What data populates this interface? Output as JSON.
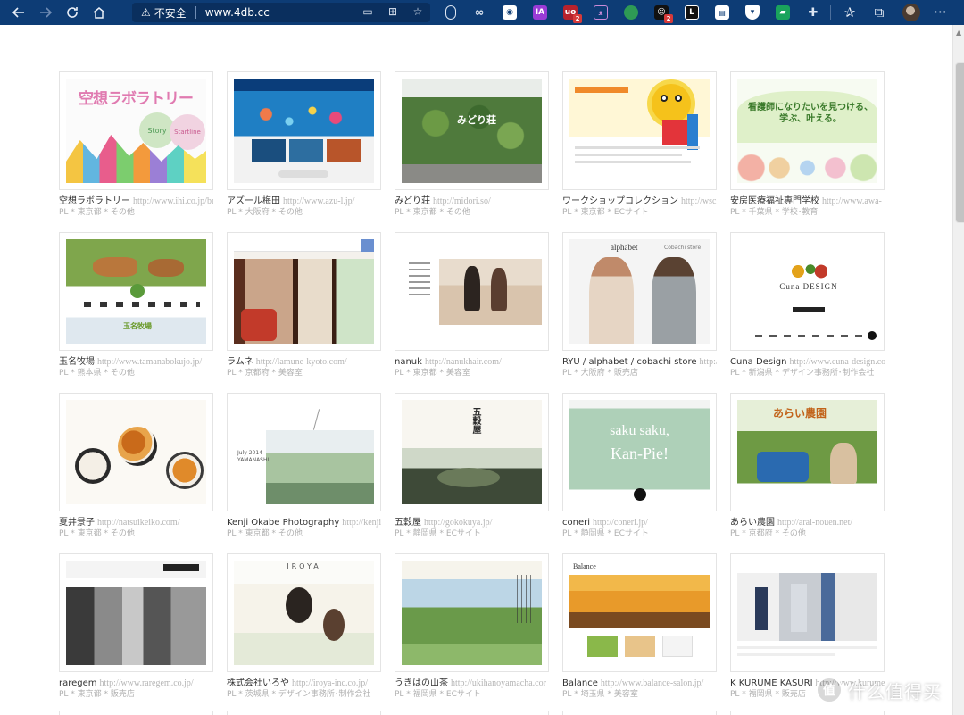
{
  "browser": {
    "security_label": "不安全",
    "url": "www.4db.cc",
    "extension_badges": [
      "2",
      "2"
    ],
    "accent": "#0d3c75"
  },
  "sites": [
    {
      "name": "空想ラボラトリー",
      "url": "http://www.ihi.co.jp/bra",
      "meta": "PL * 東京都 * その他"
    },
    {
      "name": "アズール梅田",
      "url": "http://www.azu-l.jp/",
      "meta": "PL * 大阪府 * その他"
    },
    {
      "name": "みどり荘",
      "url": "http://midori.so/",
      "meta": "PL * 東京都 * その他"
    },
    {
      "name": "ワークショップコレクション",
      "url": "http://wsc.or.jp/",
      "meta": "PL * 東京都 * ECサイト"
    },
    {
      "name": "安房医療福祉専門学校",
      "url": "http://www.awa-",
      "meta": "PL * 千葉県 * 学校･教育"
    },
    {
      "name": "玉名牧場",
      "url": "http://www.tamanabokujo.jp/",
      "meta": "PL * 熊本県 * その他"
    },
    {
      "name": "ラムネ",
      "url": "http://lamune-kyoto.com/",
      "meta": "PL * 京都府 * 美容室"
    },
    {
      "name": "nanuk",
      "url": "http://nanukhair.com/",
      "meta": "PL * 東京都 * 美容室"
    },
    {
      "name": "RYU / alphabet / cobachi store",
      "url": "http://col",
      "meta": "PL * 大阪府 * 販売店"
    },
    {
      "name": "Cuna Design",
      "url": "http://www.cuna-design.co",
      "meta": "PL * 新潟県 * デザイン事務所･制作会社"
    },
    {
      "name": "夏井景子",
      "url": "http://natsuikeiko.com/",
      "meta": "PL * 東京都 * その他"
    },
    {
      "name": "Kenji Okabe Photography",
      "url": "http://kenjioka",
      "meta": "PL * 東京都 * その他"
    },
    {
      "name": "五穀屋",
      "url": "http://gokokuya.jp/",
      "meta": "PL * 静岡県 * ECサイト"
    },
    {
      "name": "coneri",
      "url": "http://coneri.jp/",
      "meta": "PL * 静岡県 * ECサイト"
    },
    {
      "name": "あらい農園",
      "url": "http://arai-nouen.net/",
      "meta": "PL * 京都府 * その他"
    },
    {
      "name": "raregem",
      "url": "http://www.raregem.co.jp/",
      "meta": "PL * 東京都 * 販売店"
    },
    {
      "name": "株式会社いろや",
      "url": "http://iroya-inc.co.jp/",
      "meta": "PL * 茨城県 * デザイン事務所･制作会社"
    },
    {
      "name": "うきはの山茶",
      "url": "http://ukihanoyamacha.cor",
      "meta": "PL * 福岡県 * ECサイト"
    },
    {
      "name": "Balance",
      "url": "http://www.balance-salon.jp/",
      "meta": "PL * 埼玉県 * 美容室"
    },
    {
      "name": "K KURUME KASURI",
      "url": "http://www.kurume-ka",
      "meta": "PL * 福岡県 * 販売店"
    }
  ],
  "thumb_texts": {
    "kuso_title": "空想ラボラトリー",
    "kuso_story": "Story",
    "kuso_startline": "Startline",
    "midori": "みどり荘",
    "awa_headline": "看護師になりたいを見つける、学ぶ、叶える。",
    "cuna": "Cuna DESIGN",
    "alphabet": "alphabet",
    "cobachi": "Cobachi store",
    "kenji": "July 2014 YAMANASHI",
    "sakusaku": "saku saku,",
    "kanpie": "Kan-Pie!",
    "arai": "あらい農園",
    "iroya": "IROYA",
    "balance": "Balance",
    "gokokuya": "五穀屋",
    "tamana": "玉名牧場"
  },
  "watermark": {
    "mark": "值",
    "text": "什么值得买"
  }
}
